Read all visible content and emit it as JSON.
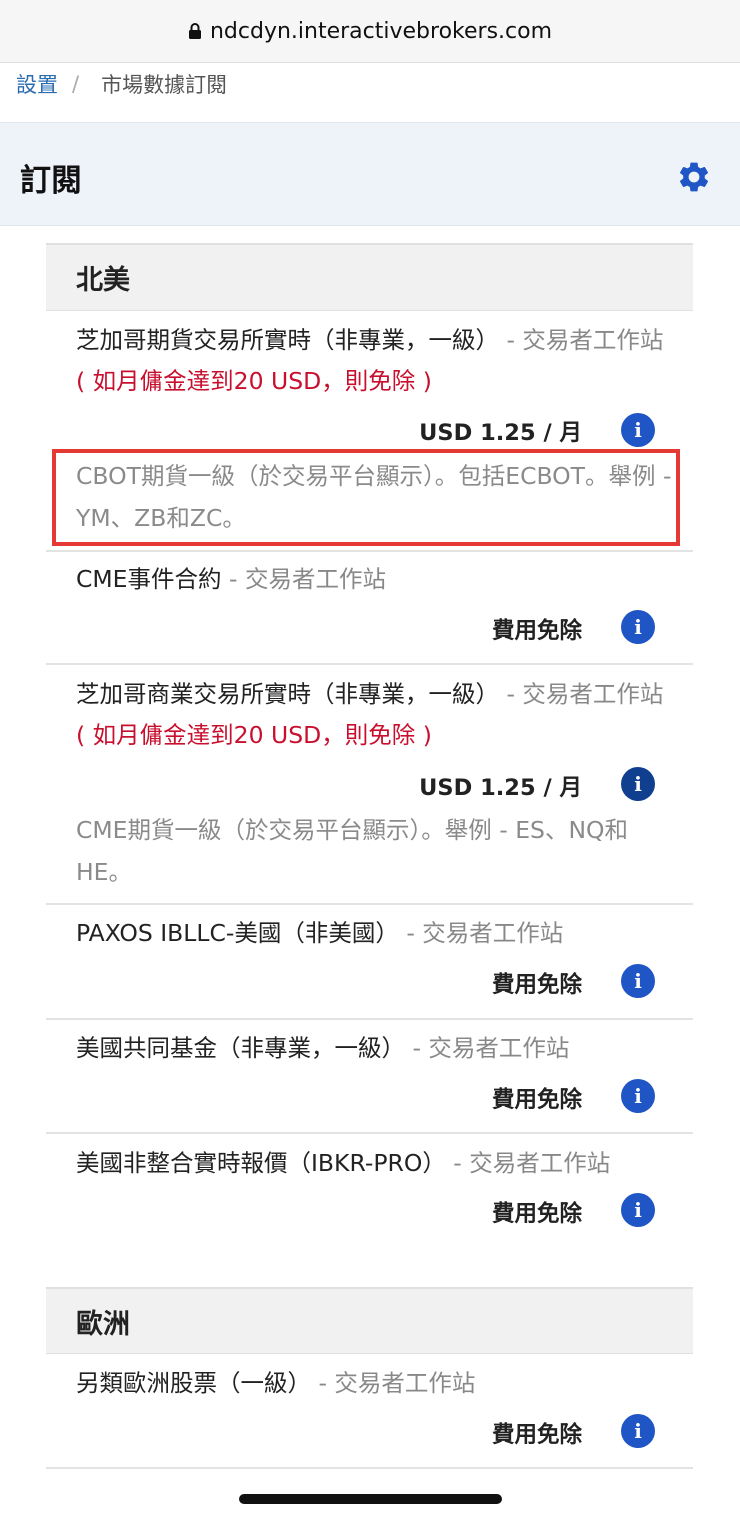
{
  "browser": {
    "url": "ndcdyn.interactivebrokers.com"
  },
  "breadcrumb": {
    "settings": "設置",
    "separator": "/",
    "current": "市場數據訂閱"
  },
  "header": {
    "title": "訂閱"
  },
  "sections": [
    {
      "title": "北美",
      "items": [
        {
          "name": "芝加哥期貨交易所實時（非專業，一級）",
          "sub": " - 交易者工作站",
          "waiver": " ( 如月傭金達到20 USD，則免除 )",
          "price": "USD 1.25 / 月",
          "desc": "CBOT期貨一級（於交易平台顯示）。包括ECBOT。舉例 - YM、ZB和ZC。"
        },
        {
          "name": "CME事件合約",
          "sub": " - 交易者工作站",
          "price": "費用免除"
        },
        {
          "name": "芝加哥商業交易所實時（非專業，一級）",
          "sub": " - 交易者工作站",
          "waiver": " ( 如月傭金達到20 USD，則免除 )",
          "price": "USD 1.25 / 月",
          "desc": "CME期貨一級（於交易平台顯示）。舉例 - ES、NQ和HE。"
        },
        {
          "name": "PAXOS IBLLC-美國（非美國）",
          "sub": " - 交易者工作站",
          "price": "費用免除"
        },
        {
          "name": "美國共同基金（非專業，一級）",
          "sub": " - 交易者工作站",
          "price": "費用免除"
        },
        {
          "name": "美國非整合實時報價（IBKR-PRO）",
          "sub": " - 交易者工作站",
          "price": "費用免除"
        }
      ]
    },
    {
      "title": "歐洲",
      "items": [
        {
          "name": "另類歐洲股票（一級）",
          "sub": " - 交易者工作站",
          "price": "費用免除"
        }
      ]
    }
  ],
  "icons": {
    "info": "info-icon",
    "settings": "gear-icon",
    "lock": "lock-icon"
  },
  "colors": {
    "accent": "#1f55c4",
    "waiver_red": "#c8102e",
    "highlight_box": "#e53935"
  }
}
